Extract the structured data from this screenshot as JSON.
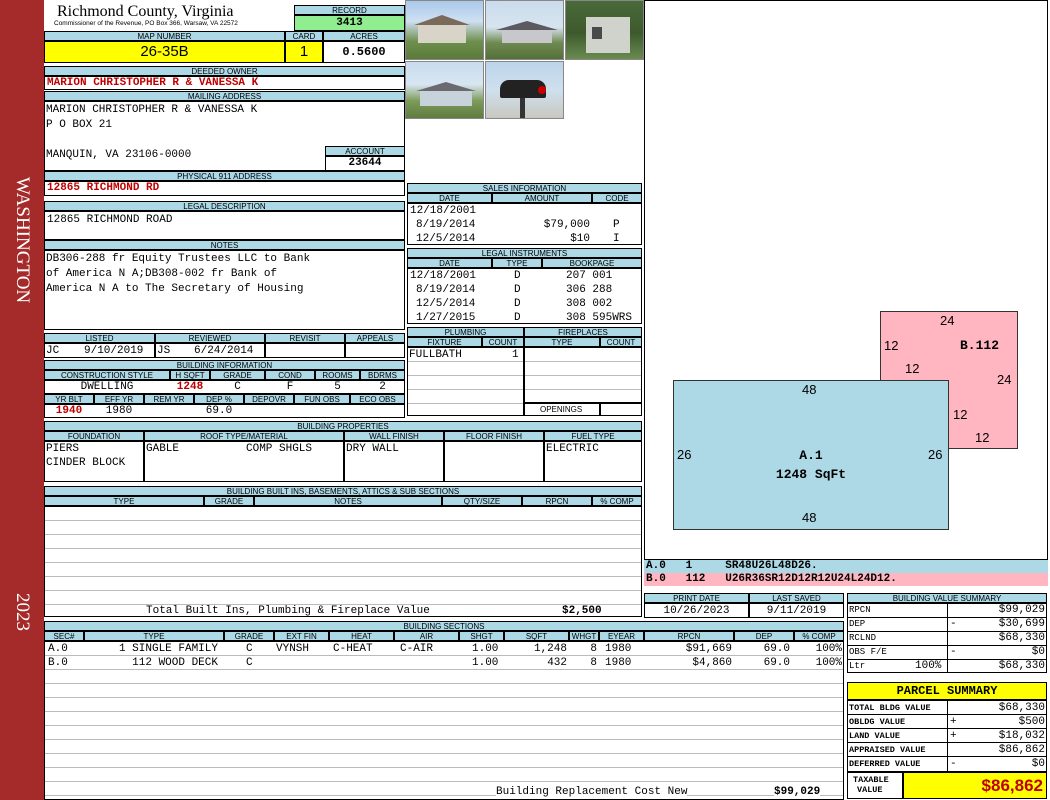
{
  "sidebar": {
    "district": "WASHINGTON",
    "year": "2023",
    "color": "#a52a2a"
  },
  "header": {
    "county": "Richmond County, Virginia",
    "commissioner": "Commissioner of the Revenue, PO Box 366, Warsaw, VA 22572",
    "record_label": "RECORD",
    "record": "3413",
    "map_label": "MAP NUMBER",
    "map_number": "26-35B",
    "card_label": "CARD",
    "card": "1",
    "acres_label": "ACRES",
    "acres": "0.5600"
  },
  "owner": {
    "deeded_label": "DEEDED OWNER",
    "deeded": "MARION CHRISTOPHER R & VANESSA K",
    "mailing_label": "MAILING ADDRESS",
    "mail1": "MARION CHRISTOPHER R & VANESSA K",
    "mail2": "P O BOX 21",
    "mail3": "MANQUIN, VA 23106-0000",
    "account_label": "ACCOUNT",
    "account": "23644",
    "phys_label": "PHYSICAL 911 ADDRESS",
    "phys": "12865 RICHMOND RD"
  },
  "legal": {
    "label": "LEGAL DESCRIPTION",
    "desc": "12865 RICHMOND ROAD"
  },
  "notes": {
    "label": "NOTES",
    "lines": [
      "DB306-288 fr Equity Trustees LLC to Bank",
      "of America N A;DB308-002 fr Bank of",
      "America N A to The Secretary of Housing"
    ]
  },
  "review": {
    "listed_label": "LISTED",
    "listed_by": "JC",
    "listed_date": "9/10/2019",
    "reviewed_label": "REVIEWED",
    "reviewed_by": "JS",
    "reviewed_date": "6/24/2014",
    "revisit_label": "REVISIT",
    "appeals_label": "APPEALS"
  },
  "building": {
    "label": "BUILDING INFORMATION",
    "h_style": "CONSTRUCTION STYLE",
    "h_sqft": "H SQFT",
    "h_grade": "GRADE",
    "h_cond": "COND",
    "h_rooms": "ROOMS",
    "h_bdrms": "BDRMS",
    "style": "DWELLING",
    "sqft": "1248",
    "grade": "C",
    "cond": "F",
    "rooms": "5",
    "bdrms": "2",
    "h_yrblt": "YR BLT",
    "h_effyr": "EFF YR",
    "h_remyr": "REM YR",
    "h_dep": "DEP %",
    "h_depovr": "DEPOVR",
    "h_funobs": "FUN OBS",
    "h_ecoobs": "ECO OBS",
    "yrblt": "1940",
    "effyr": "1980",
    "dep": "69.0"
  },
  "props": {
    "label": "BUILDING PROPERTIES",
    "h_found": "FOUNDATION",
    "h_roof": "ROOF TYPE/MATERIAL",
    "h_wall": "WALL FINISH",
    "h_floor": "FLOOR FINISH",
    "h_fuel": "FUEL TYPE",
    "found1": "PIERS",
    "found2": "CINDER BLOCK",
    "roof1": "GABLE",
    "roof2": "COMP SHGLS",
    "wall": "DRY WALL",
    "fuel": "ELECTRIC"
  },
  "builtins": {
    "label": "BUILDING BUILT INS, BASEMENTS, ATTICS & SUB SECTIONS",
    "h_type": "TYPE",
    "h_grade": "GRADE",
    "h_notes": "NOTES",
    "h_qty": "QTY/SIZE",
    "h_rpcn": "RPCN",
    "h_comp": "% COMP",
    "total_label": "Total Built Ins, Plumbing & Fireplace Value",
    "total": "$2,500"
  },
  "sales": {
    "label": "SALES INFORMATION",
    "h_date": "DATE",
    "h_amount": "AMOUNT",
    "h_code": "CODE",
    "rows": [
      [
        "12/18/2001",
        "",
        ""
      ],
      [
        "8/19/2014",
        "$79,000",
        "P"
      ],
      [
        "12/5/2014",
        "$10",
        "I"
      ]
    ]
  },
  "instruments": {
    "label": "LEGAL INSTRUMENTS",
    "h_date": "DATE",
    "h_type": "TYPE",
    "h_book": "BOOKPAGE",
    "rows": [
      [
        "12/18/2001",
        "D",
        "207 001"
      ],
      [
        "8/19/2014",
        "D",
        "306 288"
      ],
      [
        "12/5/2014",
        "D",
        "308 002"
      ],
      [
        "1/27/2015",
        "D",
        "308 595WRS"
      ]
    ]
  },
  "plumbing": {
    "label": "PLUMBING",
    "h_fixture": "FIXTURE",
    "h_count": "COUNT",
    "fixture": "FULLBATH",
    "count": "1"
  },
  "fireplaces": {
    "label": "FIREPLACES",
    "h_type": "TYPE",
    "h_count": "COUNT",
    "openings": "OPENINGS"
  },
  "sketch": {
    "a_top": "48",
    "a_bottom": "48",
    "a_left": "26",
    "a_right": "26",
    "a_name": "A.1",
    "a_area": "1248 SqFt",
    "b_top": "24",
    "b_left1": "12",
    "b_left2": "12",
    "b_right1": "24",
    "b_right2": "12",
    "b_bottom": "12",
    "b_name": "B.112",
    "a_color": "#add8e6",
    "b_color": "#ffb6c1",
    "vec_a": "A.0   1     SR48U26L48D26.",
    "vec_b": "B.0   112   U26R36SR12D12R12U24L24D12."
  },
  "print": {
    "h_print": "PRINT DATE",
    "h_saved": "LAST SAVED",
    "print_date": "10/26/2023",
    "saved": "9/11/2019"
  },
  "sections": {
    "label": "BUILDING SECTIONS",
    "headers": [
      "SEC#",
      "TYPE",
      "GRADE",
      "EXT FIN",
      "HEAT",
      "AIR",
      "SHGT",
      "SQFT",
      "WHGT",
      "EYEAR",
      "RPCN",
      "DEP",
      "% COMP"
    ],
    "rows": [
      [
        "A.0",
        "1 SINGLE FAMILY",
        "C",
        "VYNSH",
        "C-HEAT",
        "C-AIR",
        "1.00",
        "1,248",
        "8",
        "1980",
        "$91,669",
        "69.0",
        "100%"
      ],
      [
        "B.0",
        "112 WOOD DECK",
        "C",
        "",
        "",
        "",
        "1.00",
        "432",
        "8",
        "1980",
        "$4,860",
        "69.0",
        "100%"
      ]
    ],
    "repl_label": "Building Replacement Cost New",
    "repl": "$99,029"
  },
  "value_summary": {
    "label": "BUILDING VALUE SUMMARY",
    "rpcn_l": "RPCN",
    "rpcn": "$99,029",
    "dep_l": "DEP",
    "dep_s": "-",
    "dep": "$30,699",
    "rclnd_l": "RCLND",
    "rclnd": "$68,330",
    "obs_l": "OBS F/E",
    "obs_s": "-",
    "obs": "$0",
    "ltr_l": "Ltr",
    "ltr_p": "100%",
    "ltr": "$68,330"
  },
  "parcel": {
    "label": "PARCEL SUMMARY",
    "bldg_l": "TOTAL BLDG VALUE",
    "bldg": "$68,330",
    "obldg_l": "OBLDG VALUE",
    "obldg_s": "+",
    "obldg": "$500",
    "land_l": "LAND VALUE",
    "land_s": "+",
    "land": "$18,032",
    "appr_l": "APPRAISED VALUE",
    "appr": "$86,862",
    "def_l": "DEFERRED VALUE",
    "def_s": "-",
    "def": "$0",
    "tax_l1": "TAXABLE",
    "tax_l2": "VALUE",
    "tax": "$86,862"
  }
}
